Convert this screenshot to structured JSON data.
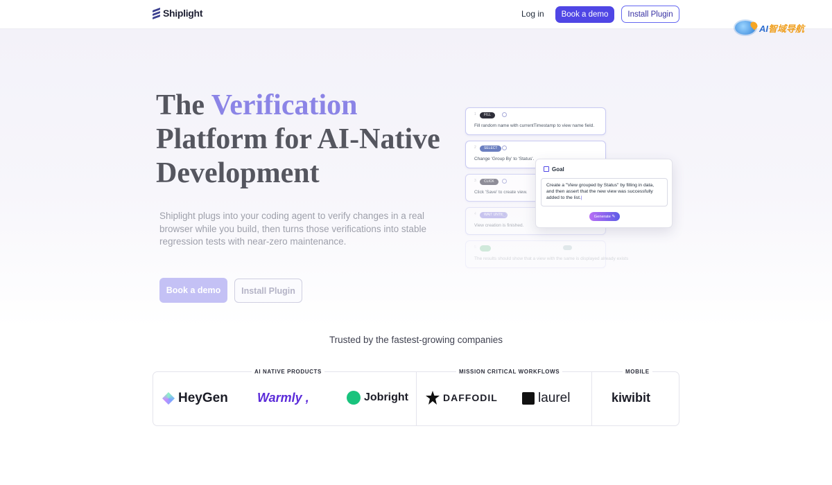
{
  "header": {
    "logo_text": "Shiplight",
    "login": "Log in",
    "book_demo": "Book a demo",
    "install_plugin": "Install Plugin",
    "watermark": {
      "prefix": "AI",
      "suffix": "智域导航"
    }
  },
  "hero": {
    "headline_part1": "The ",
    "headline_highlight": "Verification",
    "headline_part2": " Platform for AI-Native Development",
    "subtitle": "Shiplight plugs into your coding agent to verify changes in a real browser while you build, then turns those verifications into stable regression tests with near-zero maintenance.",
    "cta_primary": "Book a demo",
    "cta_secondary": "Install Plugin",
    "accent_color": "#8b84e6"
  },
  "steps": [
    {
      "num": "1",
      "tag": "FILL",
      "text": "Fill random name with currentTimestamp to view name field."
    },
    {
      "num": "2",
      "tag": "SELECT",
      "text": "Change 'Group By' to 'Status'."
    },
    {
      "num": "3",
      "tag": "CLICK",
      "text": "Click 'Save' to create view."
    },
    {
      "num": "4",
      "tag": "WAIT UNTIL",
      "text": "View creation is finished."
    },
    {
      "num": "5",
      "tag": "",
      "text": "The results should show that a view with the same is displayed already exists"
    }
  ],
  "goal": {
    "title": "Goal",
    "text": "Create a \"View grouped by Status\" by filling in data, and then assert that the new view was successfully added to the list.",
    "button": "Generate"
  },
  "trusted": {
    "heading": "Trusted by the fastest-growing companies",
    "categories": [
      "AI NATIVE PRODUCTS",
      "MISSION CRITICAL WORKFLOWS",
      "MOBILE"
    ],
    "companies": [
      "HeyGen",
      "Warmly",
      "Jobright",
      "DAFFODIL",
      "laurel",
      "kiwibit"
    ]
  }
}
